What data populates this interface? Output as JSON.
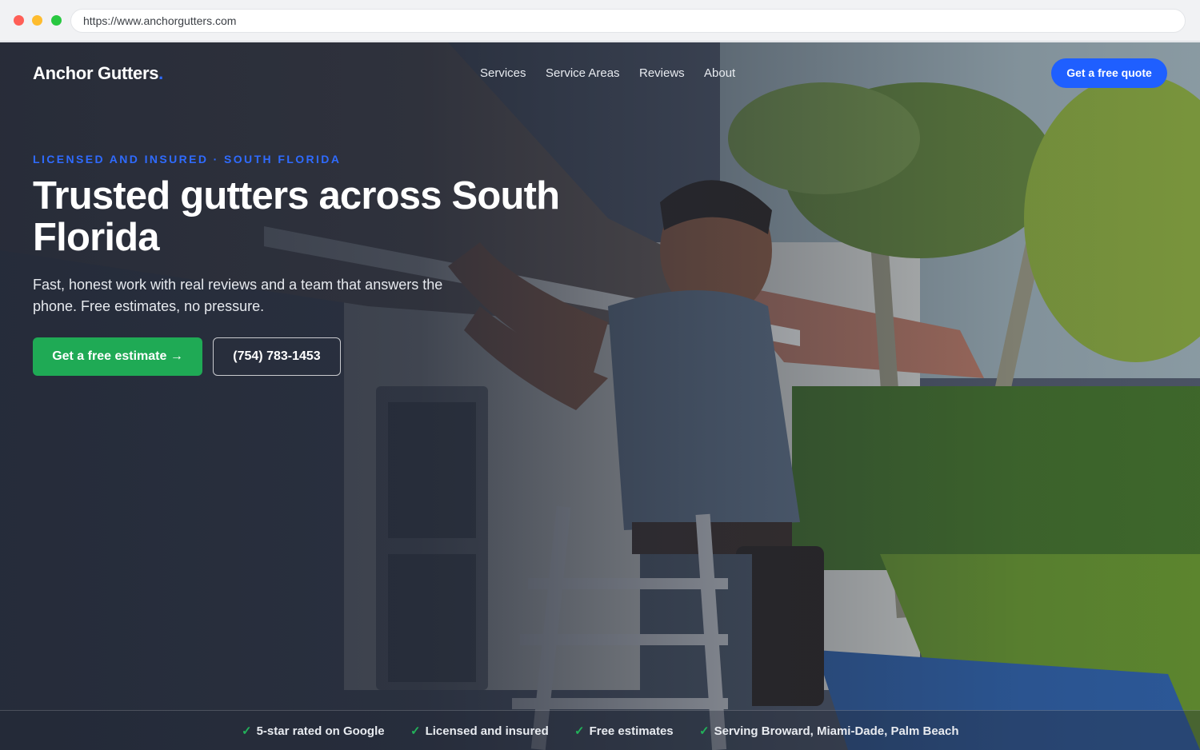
{
  "browser": {
    "url": "https://www.anchorgutters.com"
  },
  "header": {
    "logo_text": "Anchor Gutters",
    "logo_dot": ".",
    "nav": [
      "Services",
      "Service Areas",
      "Reviews",
      "About"
    ],
    "quote_button": "Get a free quote"
  },
  "hero": {
    "eyebrow": "LICENSED AND INSURED · SOUTH FLORIDA",
    "headline": "Trusted gutters across South Florida",
    "subcopy": "Fast, honest work with real reviews and a team that answers the phone. Free estimates, no pressure.",
    "cta_primary": "Get a free estimate →",
    "cta_phone": "(754) 783-1453"
  },
  "trust_bar": {
    "check_icon": "✓",
    "items": [
      "5-star rated on Google",
      "Licensed and insured",
      "Free estimates",
      "Serving Broward, Miami-Dade, Palm Beach"
    ]
  },
  "colors": {
    "accent_blue": "#1f5fff",
    "cta_green": "#1faa55",
    "check_green": "#22b25a"
  }
}
